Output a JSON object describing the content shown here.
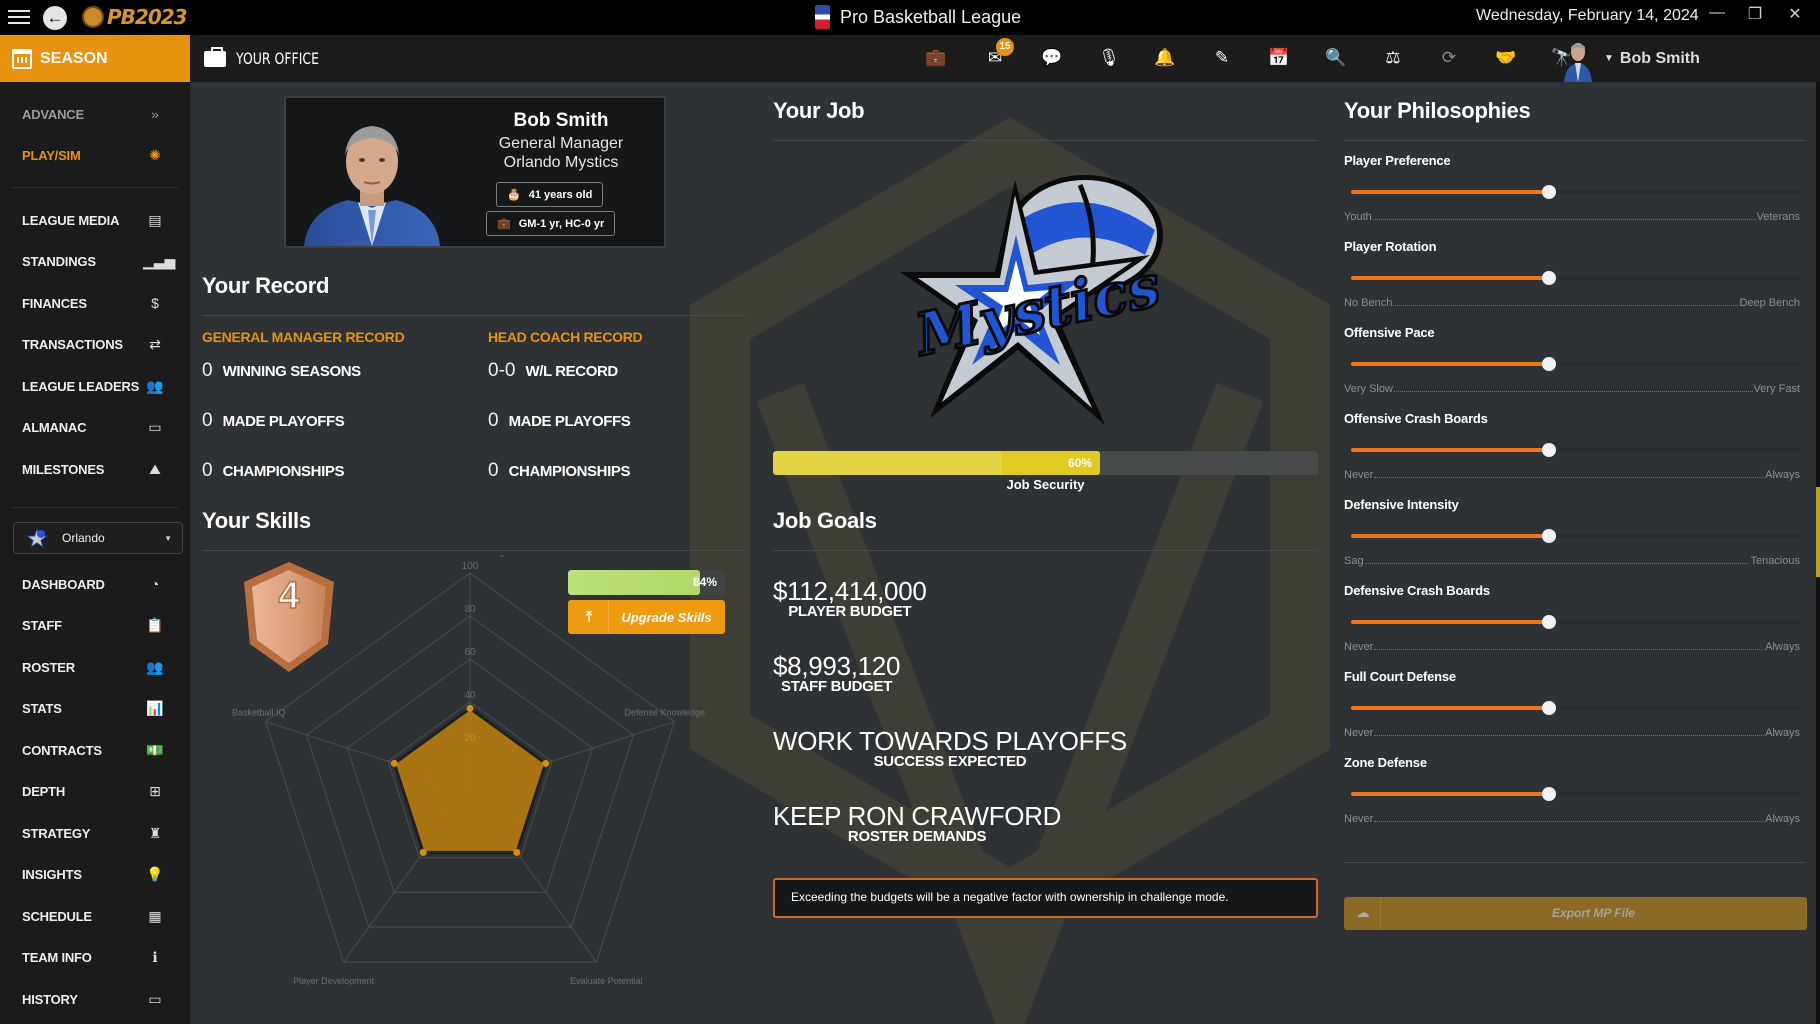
{
  "titlebar": {
    "app_logo_text": "PB2023",
    "league_title": "Pro Basketball League",
    "date": "Wednesday, February 14, 2024",
    "window_controls": {
      "minimize": "—",
      "restore": "❐",
      "close": "✕"
    }
  },
  "topnav": {
    "season_label": "SEASON",
    "office_label": "YOUR OFFICE",
    "icons": [
      {
        "name": "briefcase-icon",
        "glyph": "💼"
      },
      {
        "name": "mail-icon",
        "glyph": "✉",
        "badge": "15"
      },
      {
        "name": "chat-icon",
        "glyph": "💬"
      },
      {
        "name": "microphone-icon",
        "glyph": "🎙"
      },
      {
        "name": "bell-icon",
        "glyph": "🔔"
      },
      {
        "name": "edit-icon",
        "glyph": "✎"
      },
      {
        "name": "calendar-check-icon",
        "glyph": "📅"
      },
      {
        "name": "search-icon",
        "glyph": "🔍"
      },
      {
        "name": "scale-icon",
        "glyph": "⚖"
      },
      {
        "name": "sync-icon",
        "glyph": "⟳"
      },
      {
        "name": "handshake-icon",
        "glyph": "🤝"
      },
      {
        "name": "binoculars-icon",
        "glyph": "🔭"
      }
    ],
    "user_name": "Bob Smith"
  },
  "sidebar": {
    "top_items": [
      {
        "label": "ADVANCE",
        "icon": "»",
        "state": "muted"
      },
      {
        "label": "PLAY/SIM",
        "icon": "✺",
        "state": "active"
      }
    ],
    "league_items": [
      {
        "label": "LEAGUE MEDIA",
        "icon": "▤"
      },
      {
        "label": "STANDINGS",
        "icon": "▁▃▅"
      },
      {
        "label": "FINANCES",
        "icon": "$"
      },
      {
        "label": "TRANSACTIONS",
        "icon": "⇄"
      },
      {
        "label": "LEAGUE LEADERS",
        "icon": "👥"
      },
      {
        "label": "ALMANAC",
        "icon": "▭"
      },
      {
        "label": "MILESTONES",
        "icon": "⛰"
      }
    ],
    "team_select": {
      "value": "Orlando"
    },
    "team_items": [
      {
        "label": "DASHBOARD",
        "icon": "◔"
      },
      {
        "label": "STAFF",
        "icon": "📋"
      },
      {
        "label": "ROSTER",
        "icon": "👥"
      },
      {
        "label": "STATS",
        "icon": "📊"
      },
      {
        "label": "CONTRACTS",
        "icon": "💵"
      },
      {
        "label": "DEPTH",
        "icon": "⊞"
      },
      {
        "label": "STRATEGY",
        "icon": "♜"
      },
      {
        "label": "INSIGHTS",
        "icon": "💡"
      },
      {
        "label": "SCHEDULE",
        "icon": "▦"
      },
      {
        "label": "TEAM INFO",
        "icon": "ℹ"
      },
      {
        "label": "HISTORY",
        "icon": "▭"
      }
    ]
  },
  "profile": {
    "name": "Bob Smith",
    "role": "General Manager",
    "team": "Orlando Mystics",
    "age": "41 years old",
    "tenure": "GM-1 yr, HC-0 yr"
  },
  "record": {
    "title": "Your Record",
    "gm": {
      "heading": "GENERAL MANAGER RECORD",
      "rows": [
        {
          "value": "0",
          "label": "WINNING SEASONS"
        },
        {
          "value": "0",
          "label": "MADE PLAYOFFS"
        },
        {
          "value": "0",
          "label": "CHAMPIONSHIPS"
        }
      ]
    },
    "hc": {
      "heading": "HEAD COACH RECORD",
      "rows": [
        {
          "value": "0-0",
          "label": "W/L RECORD"
        },
        {
          "value": "0",
          "label": "MADE PLAYOFFS"
        },
        {
          "value": "0",
          "label": "CHAMPIONSHIPS"
        }
      ]
    }
  },
  "skills": {
    "title": "Your Skills",
    "rank": "4",
    "progress_percent": 84,
    "progress_label": "84%",
    "upgrade_label": "Upgrade Skills"
  },
  "chart_data": {
    "type": "radar",
    "title": "",
    "axes": [
      "Offense Knowledge",
      "Defense Knowledge",
      "Evaluate Potential",
      "Player Development",
      "Basketball IQ"
    ],
    "values": [
      37,
      37,
      37,
      37,
      37
    ],
    "range": [
      0,
      100
    ],
    "ticks": [
      20,
      40,
      60,
      80,
      100
    ],
    "tick_labels": [
      "20",
      "40",
      "60",
      "80",
      "100"
    ],
    "grid": true,
    "series_color": "#b5790f"
  },
  "job": {
    "title": "Your Job",
    "security_percent": 60,
    "security_label": "60%",
    "security_caption": "Job Security",
    "goals_title": "Job Goals",
    "goals": [
      {
        "big": "$112,414,000",
        "sub": "PLAYER BUDGET"
      },
      {
        "big": "$8,993,120",
        "sub": "STAFF BUDGET"
      },
      {
        "big": "WORK TOWARDS PLAYOFFS",
        "sub": "SUCCESS EXPECTED"
      },
      {
        "big": "KEEP RON CRAWFORD",
        "sub": "ROSTER DEMANDS"
      }
    ],
    "notice": "Exceeding the budgets will be a negative factor with ownership in challenge mode."
  },
  "philosophies": {
    "title": "Your Philosophies",
    "items": [
      {
        "label": "Player Preference",
        "min": "Youth",
        "max": "Veterans",
        "value_percent": 44
      },
      {
        "label": "Player Rotation",
        "min": "No Bench",
        "max": "Deep Bench",
        "value_percent": 44
      },
      {
        "label": "Offensive Pace",
        "min": "Very Slow",
        "max": "Very Fast",
        "value_percent": 44
      },
      {
        "label": "Offensive Crash Boards",
        "min": "Never",
        "max": "Always",
        "value_percent": 44
      },
      {
        "label": "Defensive Intensity",
        "min": "Sag",
        "max": "Tenacious",
        "value_percent": 44
      },
      {
        "label": "Defensive Crash Boards",
        "min": "Never",
        "max": "Always",
        "value_percent": 44
      },
      {
        "label": "Full Court Defense",
        "min": "Never",
        "max": "Always",
        "value_percent": 44
      },
      {
        "label": "Zone Defense",
        "min": "Never",
        "max": "Always",
        "value_percent": 44
      }
    ],
    "export_label": "Export MP File"
  }
}
